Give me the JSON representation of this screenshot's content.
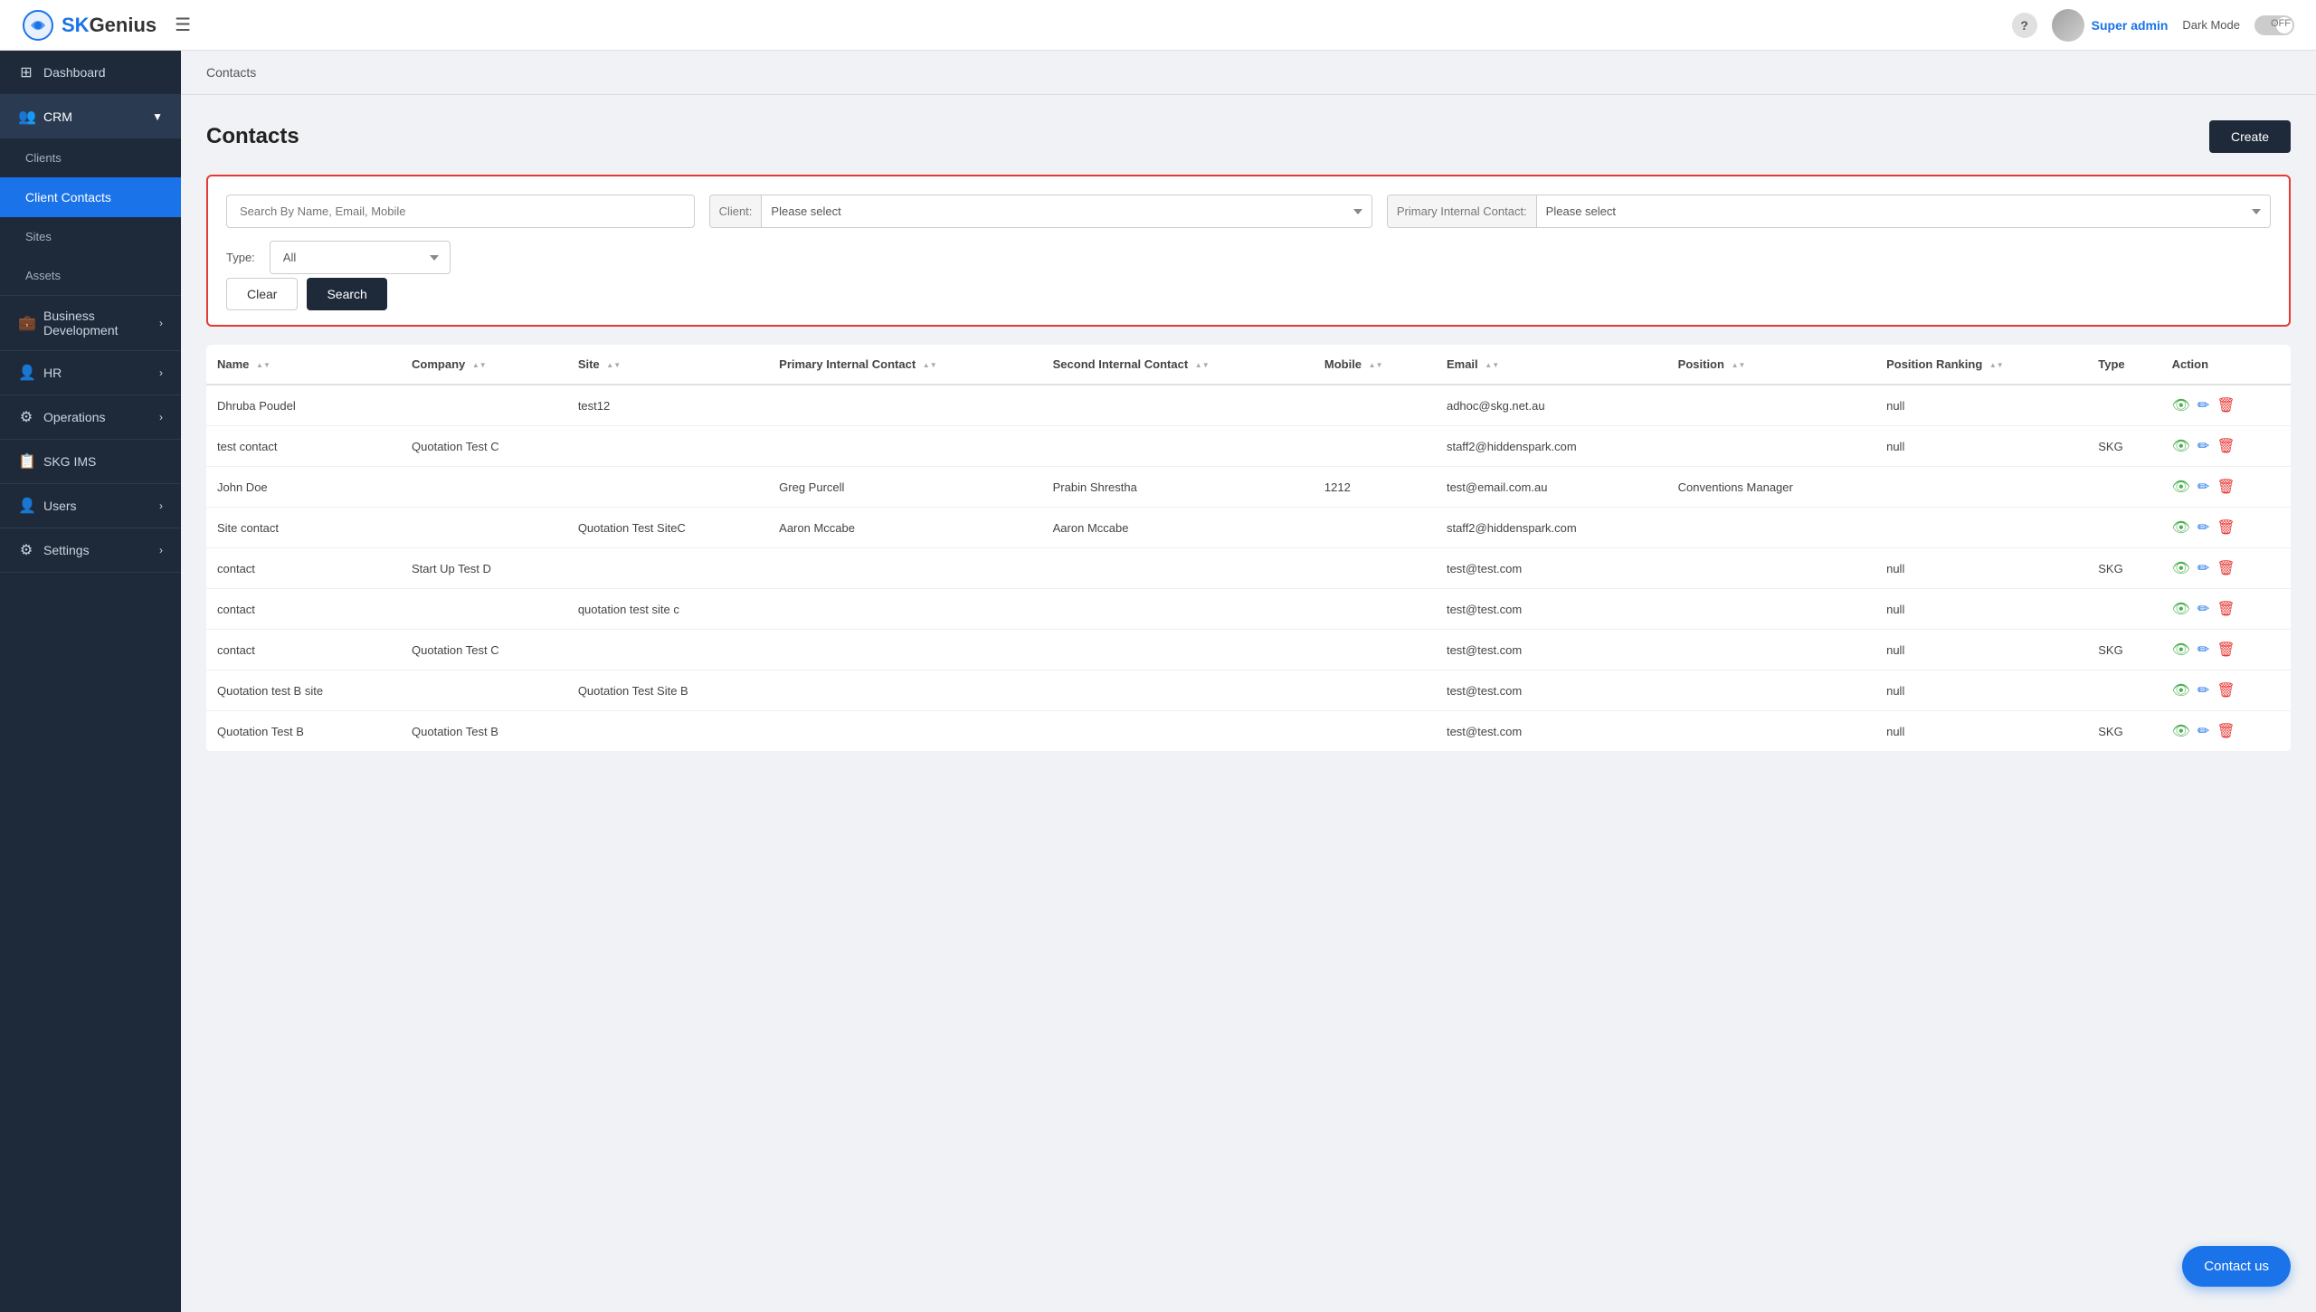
{
  "app": {
    "name": "SKGenius",
    "logo_alt": "SKGenius Logo"
  },
  "header": {
    "hamburger_label": "☰",
    "help_label": "?",
    "user_name": "Super admin",
    "dark_mode_label": "Dark Mode",
    "toggle_state": "OFF"
  },
  "sidebar": {
    "items": [
      {
        "id": "dashboard",
        "label": "Dashboard",
        "icon": "⊞",
        "active": false
      },
      {
        "id": "crm",
        "label": "CRM",
        "icon": "👥",
        "active": true,
        "has_children": true
      },
      {
        "id": "clients",
        "label": "Clients",
        "sub": true,
        "active": false
      },
      {
        "id": "client-contacts",
        "label": "Client Contacts",
        "sub": true,
        "active": true
      },
      {
        "id": "sites",
        "label": "Sites",
        "sub": true,
        "active": false
      },
      {
        "id": "assets",
        "label": "Assets",
        "sub": true,
        "active": false
      },
      {
        "id": "business-dev",
        "label": "Business Development",
        "icon": "💼",
        "active": false,
        "has_children": true
      },
      {
        "id": "hr",
        "label": "HR",
        "icon": "👤",
        "active": false,
        "has_children": true
      },
      {
        "id": "operations",
        "label": "Operations",
        "icon": "⚙",
        "active": false,
        "has_children": true
      },
      {
        "id": "skg-ims",
        "label": "SKG IMS",
        "icon": "📋",
        "active": false
      },
      {
        "id": "users",
        "label": "Users",
        "icon": "👤",
        "active": false,
        "has_children": true
      },
      {
        "id": "settings",
        "label": "Settings",
        "icon": "⚙",
        "active": false,
        "has_children": true
      }
    ]
  },
  "breadcrumb": {
    "text": "Contacts"
  },
  "page": {
    "title": "Contacts",
    "create_button": "Create"
  },
  "search": {
    "name_placeholder": "Search By Name, Email, Mobile",
    "client_label": "Client:",
    "client_placeholder": "Please select",
    "primary_contact_label": "Primary Internal Contact:",
    "primary_contact_placeholder": "Please select",
    "type_label": "Type:",
    "type_value": "All",
    "clear_button": "Clear",
    "search_button": "Search"
  },
  "table": {
    "columns": [
      {
        "id": "name",
        "label": "Name"
      },
      {
        "id": "company",
        "label": "Company"
      },
      {
        "id": "site",
        "label": "Site"
      },
      {
        "id": "primary_internal_contact",
        "label": "Primary Internal Contact"
      },
      {
        "id": "second_internal_contact",
        "label": "Second Internal Contact"
      },
      {
        "id": "mobile",
        "label": "Mobile"
      },
      {
        "id": "email",
        "label": "Email"
      },
      {
        "id": "position",
        "label": "Position"
      },
      {
        "id": "position_ranking",
        "label": "Position Ranking"
      },
      {
        "id": "type",
        "label": "Type"
      },
      {
        "id": "action",
        "label": "Action"
      }
    ],
    "rows": [
      {
        "name": "Dhruba Poudel",
        "company": "",
        "site": "test12",
        "primary_internal_contact": "",
        "second_internal_contact": "",
        "mobile": "",
        "email": "adhoc@skg.net.au",
        "position": "",
        "position_ranking": "null",
        "type": "",
        "actions": true
      },
      {
        "name": "test contact",
        "company": "Quotation Test C",
        "site": "",
        "primary_internal_contact": "",
        "second_internal_contact": "",
        "mobile": "",
        "email": "staff2@hiddenspark.com",
        "position": "",
        "position_ranking": "null",
        "type": "SKG",
        "actions": true
      },
      {
        "name": "John Doe",
        "company": "",
        "site": "",
        "primary_internal_contact": "Greg Purcell",
        "second_internal_contact": "Prabin Shrestha",
        "mobile": "1212",
        "email": "test@email.com.au",
        "position": "Conventions Manager",
        "position_ranking": "",
        "type": "",
        "actions": true
      },
      {
        "name": "Site contact",
        "company": "",
        "site": "Quotation Test SiteC",
        "primary_internal_contact": "Aaron Mccabe",
        "second_internal_contact": "Aaron Mccabe",
        "mobile": "",
        "email": "staff2@hiddenspark.com",
        "position": "",
        "position_ranking": "",
        "type": "",
        "actions": true
      },
      {
        "name": "contact",
        "company": "Start Up Test D",
        "site": "",
        "primary_internal_contact": "",
        "second_internal_contact": "",
        "mobile": "",
        "email": "test@test.com",
        "position": "",
        "position_ranking": "null",
        "type": "SKG",
        "actions": true
      },
      {
        "name": "contact",
        "company": "",
        "site": "quotation test site c",
        "primary_internal_contact": "",
        "second_internal_contact": "",
        "mobile": "",
        "email": "test@test.com",
        "position": "",
        "position_ranking": "null",
        "type": "",
        "actions": true
      },
      {
        "name": "contact",
        "company": "Quotation Test C",
        "site": "",
        "primary_internal_contact": "",
        "second_internal_contact": "",
        "mobile": "",
        "email": "test@test.com",
        "position": "",
        "position_ranking": "null",
        "type": "SKG",
        "actions": true
      },
      {
        "name": "Quotation test B site",
        "company": "",
        "site": "Quotation Test Site B",
        "primary_internal_contact": "",
        "second_internal_contact": "",
        "mobile": "",
        "email": "test@test.com",
        "position": "",
        "position_ranking": "null",
        "type": "",
        "actions": true
      },
      {
        "name": "Quotation Test B",
        "company": "Quotation Test B",
        "site": "",
        "primary_internal_contact": "",
        "second_internal_contact": "",
        "mobile": "",
        "email": "test@test.com",
        "position": "",
        "position_ranking": "null",
        "type": "SKG",
        "actions": true
      }
    ]
  },
  "contact_us": {
    "label": "Contact us"
  }
}
